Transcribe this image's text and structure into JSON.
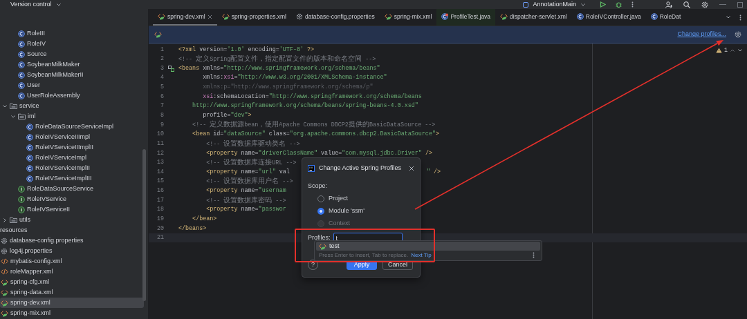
{
  "top_bar": {
    "project_widget": "Version control",
    "run_config": "AnnotationMain"
  },
  "sidebar": {
    "continued_items": [
      {
        "label": "RoleIII",
        "kind": "class",
        "selected": false
      },
      {
        "label": "RoleIV",
        "kind": "class",
        "selected": false
      },
      {
        "label": "Source",
        "kind": "class",
        "selected": false
      },
      {
        "label": "SoybeanMilkMaker",
        "kind": "class",
        "selected": false
      },
      {
        "label": "SoybeanMilkMakerII",
        "kind": "class",
        "selected": false
      },
      {
        "label": "User",
        "kind": "class",
        "selected": false
      },
      {
        "label": "UserRoleAssembly",
        "kind": "class",
        "selected": false
      }
    ],
    "tree": [
      {
        "label": "service",
        "kind": "folder",
        "expanded": true,
        "selected": false,
        "children": [
          {
            "label": "iml",
            "kind": "folder",
            "expanded": true,
            "selected": false,
            "children": [
              {
                "label": "RoleDataSourceServiceImpl",
                "kind": "class",
                "selected": false
              },
              {
                "label": "RoleIVServiceIIImpl",
                "kind": "class",
                "selected": false
              },
              {
                "label": "RoleIVServiceIIImplII",
                "kind": "class",
                "selected": false
              },
              {
                "label": "RoleIVServiceImpl",
                "kind": "class",
                "selected": false
              },
              {
                "label": "RoleIVServiceImplII",
                "kind": "class",
                "selected": false
              },
              {
                "label": "RoleIVServiceImplIII",
                "kind": "class",
                "selected": false
              }
            ]
          },
          {
            "label": "RoleDataSourceService",
            "kind": "interface",
            "selected": false
          },
          {
            "label": "RoleIVService",
            "kind": "interface",
            "selected": false
          },
          {
            "label": "RoleIVServiceII",
            "kind": "interface",
            "selected": false
          }
        ]
      },
      {
        "label": "utils",
        "kind": "folder",
        "expanded": false,
        "selected": false
      },
      {
        "label": "resources",
        "kind": "root",
        "selected": false,
        "children": [
          {
            "label": "database-config.properties",
            "kind": "properties",
            "selected": false
          },
          {
            "label": "log4j.properties",
            "kind": "properties",
            "selected": false
          },
          {
            "label": "mybatis-config.xml",
            "kind": "xml",
            "selected": false
          },
          {
            "label": "roleMapper.xml",
            "kind": "xml",
            "selected": false
          },
          {
            "label": "spring-cfg.xml",
            "kind": "spring-xml",
            "selected": false
          },
          {
            "label": "spring-data.xml",
            "kind": "spring-xml",
            "selected": false
          },
          {
            "label": "spring-dev.xml",
            "kind": "spring-xml",
            "selected": true
          },
          {
            "label": "spring-mix.xml",
            "kind": "spring-xml",
            "selected": false
          }
        ]
      }
    ]
  },
  "tabs": [
    {
      "label": "spring-dev.xml",
      "kind": "spring-xml",
      "selected": true
    },
    {
      "label": "spring-properties.xml",
      "kind": "spring-xml",
      "selected": false
    },
    {
      "label": "database-config.properties",
      "kind": "properties",
      "selected": false
    },
    {
      "label": "spring-mix.xml",
      "kind": "spring-xml",
      "selected": false
    },
    {
      "label": "ProfileTest.java",
      "kind": "test",
      "selected": false
    },
    {
      "label": "dispatcher-servlet.xml",
      "kind": "spring-xml",
      "selected": false
    },
    {
      "label": "RoleIVController.java",
      "kind": "class",
      "selected": false
    },
    {
      "label": "RoleDat",
      "kind": "class",
      "selected": false
    }
  ],
  "banner": {
    "link": "Change profiles..."
  },
  "editor": {
    "problem_count": "1",
    "lines": [
      {
        "number": "1",
        "current": false,
        "tokens": [
          {
            "kind": "tag",
            "text": "<?xml "
          },
          {
            "kind": "attr",
            "text": "version"
          },
          {
            "kind": "text",
            "text": "="
          },
          {
            "kind": "value",
            "text": "'1.0'"
          },
          {
            "kind": "attr",
            "text": " encoding"
          },
          {
            "kind": "text",
            "text": "="
          },
          {
            "kind": "value",
            "text": "'UTF-8'"
          },
          {
            "kind": "tag",
            "text": " ?>"
          }
        ]
      },
      {
        "number": "2",
        "current": false,
        "tokens": [
          {
            "kind": "comment",
            "text": "<!-- 定义Spring配置文件，指定配置文件的版本和命名空间 -->"
          }
        ]
      },
      {
        "number": "3",
        "current": false,
        "marker": true,
        "tokens": [
          {
            "kind": "tag",
            "text": "<beans "
          },
          {
            "kind": "attr",
            "text": "xmlns"
          },
          {
            "kind": "text",
            "text": "="
          },
          {
            "kind": "value",
            "text": "\"http://www.springframework.org/schema/beans\""
          }
        ]
      },
      {
        "number": "4",
        "current": false,
        "tokens": [
          {
            "kind": "attr",
            "text": "       xmlns:"
          },
          {
            "kind": "ns",
            "text": "xsi"
          },
          {
            "kind": "text",
            "text": "="
          },
          {
            "kind": "value",
            "text": "\"http://www.w3.org/2001/XMLSchema-instance\""
          }
        ]
      },
      {
        "number": "5",
        "current": false,
        "tokens": [
          {
            "kind": "unused",
            "text": "       xmlns:p=\"http://www.springframework.org/schema/p\""
          }
        ]
      },
      {
        "number": "6",
        "current": false,
        "tokens": [
          {
            "kind": "ns",
            "text": "       xsi"
          },
          {
            "kind": "attr",
            "text": ":schemaLocation"
          },
          {
            "kind": "text",
            "text": "="
          },
          {
            "kind": "value",
            "text": "\"http://www.springframework.org/schema/beans"
          }
        ]
      },
      {
        "number": "7",
        "current": false,
        "tokens": [
          {
            "kind": "value",
            "text": "    http://www.springframework.org/schema/beans/spring-beans-4.0.xsd\""
          }
        ]
      },
      {
        "number": "8",
        "current": false,
        "tokens": [
          {
            "kind": "attr",
            "text": "       profile"
          },
          {
            "kind": "text",
            "text": "="
          },
          {
            "kind": "value",
            "text": "\"dev\""
          },
          {
            "kind": "tag",
            "text": ">"
          }
        ]
      },
      {
        "number": "9",
        "current": false,
        "tokens": [
          {
            "kind": "comment",
            "text": "    <!-- 定义数据源bean，使用Apache Commons DBCP2提供的BasicDataSource -->"
          }
        ]
      },
      {
        "number": "10",
        "current": false,
        "tokens": [
          {
            "kind": "tag",
            "text": "    <bean "
          },
          {
            "kind": "attr",
            "text": "id"
          },
          {
            "kind": "text",
            "text": "="
          },
          {
            "kind": "value",
            "text": "\"dataSource\""
          },
          {
            "kind": "attr",
            "text": " class"
          },
          {
            "kind": "text",
            "text": "="
          },
          {
            "kind": "value",
            "text": "\"org.apache.commons.dbcp2.BasicDataSource\""
          },
          {
            "kind": "tag",
            "text": ">"
          }
        ]
      },
      {
        "number": "11",
        "current": false,
        "tokens": [
          {
            "kind": "comment",
            "text": "        <!-- 设置数据库驱动类名 -->"
          }
        ]
      },
      {
        "number": "12",
        "current": false,
        "tokens": [
          {
            "kind": "tag",
            "text": "        <property "
          },
          {
            "kind": "attr",
            "text": "name"
          },
          {
            "kind": "text",
            "text": "="
          },
          {
            "kind": "value",
            "text": "\"driverClassName\""
          },
          {
            "kind": "attr",
            "text": " value"
          },
          {
            "kind": "text",
            "text": "="
          },
          {
            "kind": "value",
            "text": "\"com.mysql.jdbc.Driver\""
          },
          {
            "kind": "tag",
            "text": " />"
          }
        ]
      },
      {
        "number": "13",
        "current": false,
        "tokens": [
          {
            "kind": "comment",
            "text": "        <!-- 设置数据库连接URL -->"
          }
        ]
      },
      {
        "number": "14",
        "current": false,
        "tokens": [
          {
            "kind": "tag",
            "text": "        <property "
          },
          {
            "kind": "attr",
            "text": "name"
          },
          {
            "kind": "text",
            "text": "="
          },
          {
            "kind": "value",
            "text": "\"url\""
          },
          {
            "kind": "attr",
            "text": " val"
          }
        ],
        "tail": [
          {
            "kind": "value",
            "text": "\""
          },
          {
            "kind": "tag",
            "text": " />"
          }
        ]
      },
      {
        "number": "15",
        "current": false,
        "tokens": [
          {
            "kind": "comment",
            "text": "        <!-- 设置数据库用户名 -->"
          }
        ]
      },
      {
        "number": "16",
        "current": false,
        "tokens": [
          {
            "kind": "tag",
            "text": "        <property "
          },
          {
            "kind": "attr",
            "text": "name"
          },
          {
            "kind": "text",
            "text": "="
          },
          {
            "kind": "value",
            "text": "\"usernam"
          }
        ]
      },
      {
        "number": "17",
        "current": false,
        "tokens": [
          {
            "kind": "comment",
            "text": "        <!-- 设置数据库密码 -->"
          }
        ]
      },
      {
        "number": "18",
        "current": false,
        "tokens": [
          {
            "kind": "tag",
            "text": "        <property "
          },
          {
            "kind": "attr",
            "text": "name"
          },
          {
            "kind": "text",
            "text": "="
          },
          {
            "kind": "value",
            "text": "\"passwor"
          }
        ]
      },
      {
        "number": "19",
        "current": false,
        "tokens": [
          {
            "kind": "tag",
            "text": "    </bean>"
          }
        ]
      },
      {
        "number": "20",
        "current": false,
        "tokens": [
          {
            "kind": "tag",
            "text": "</beans>"
          }
        ]
      },
      {
        "number": "21",
        "current": true
      }
    ]
  },
  "dialog": {
    "title": "Change Active Spring Profiles",
    "scope_label": "Scope:",
    "scopes": [
      {
        "label": "Project",
        "selected": false,
        "disabled": false
      },
      {
        "label": "Module 'ssm'",
        "selected": true,
        "disabled": false
      },
      {
        "label": "Context",
        "selected": false,
        "disabled": true
      }
    ],
    "profiles_label": "Profiles:",
    "profiles_value": "t",
    "help": "?",
    "buttons": [
      {
        "label": "Apply",
        "kind": "primary"
      },
      {
        "label": "Cancel",
        "kind": "secondary"
      }
    ]
  },
  "completion": {
    "items": [
      {
        "label": "test",
        "selected": true
      }
    ],
    "hint": "Press Enter to insert, Tab to replace.",
    "hint_link": "Next Tip"
  }
}
